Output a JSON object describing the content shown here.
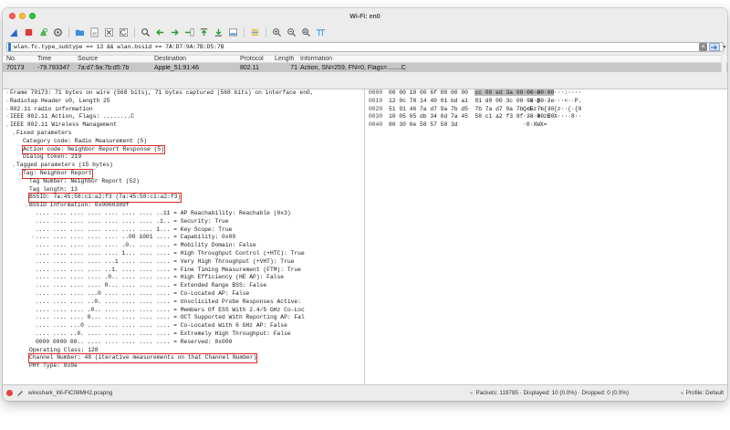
{
  "window": {
    "title": "Wi-Fi: en0"
  },
  "toolbar": {
    "buttons": [
      "shark-fin-icon",
      "stop-icon",
      "restart-icon",
      "options-gear-icon",
      "open-folder-icon",
      "save-file-icon",
      "close-file-icon",
      "reload-icon",
      "find-icon",
      "back-arrow-icon",
      "forward-arrow-icon",
      "go-to-packet-icon",
      "first-packet-icon",
      "last-packet-icon",
      "autoscroll-icon",
      "colorize-icon",
      "zoom-in-icon",
      "zoom-out-icon",
      "normal-size-icon",
      "resize-columns-icon"
    ]
  },
  "filter": {
    "text": "wlan.fc.type_subtype == 13 && wlan.bssid == 7A:D7:9A:7B:D5:7B"
  },
  "packet_list": {
    "headers": [
      "No.",
      "Time",
      "Source",
      "Destination",
      "Protocol",
      "Length",
      "Information"
    ],
    "rows": [
      {
        "no": "70173",
        "time": "-79.783347",
        "source": "7a:d7:9a:7b:d5:7b",
        "destination": "Apple_51:91:46",
        "protocol": "802.11",
        "length": "71",
        "info": "Action, SN=259, FN=0, Flags=........C"
      }
    ]
  },
  "details": {
    "lines": [
      {
        "indent": 0,
        "arrow": ">",
        "text": "Frame 70173: 71 bytes on wire (568 bits), 71 bytes captured (568 bits) on interface en0,",
        "sel": false
      },
      {
        "indent": 0,
        "arrow": ">",
        "text": "Radiotap Header v0, Length 25",
        "sel": false
      },
      {
        "indent": 0,
        "arrow": ">",
        "text": "802.11 radio information",
        "sel": false
      },
      {
        "indent": 0,
        "arrow": ">",
        "text": "IEEE 802.11 Action, Flags: ........C",
        "sel": false
      },
      {
        "indent": 0,
        "arrow": "v",
        "text": "IEEE 802.11 Wireless Management",
        "sel": false
      },
      {
        "indent": 1,
        "arrow": "v",
        "text": "Fixed parameters",
        "sel": false
      },
      {
        "indent": 2,
        "arrow": "",
        "text": "Category code: Radio Measurement (5)",
        "sel": false
      },
      {
        "indent": 2,
        "arrow": "",
        "text": "Action code: Neighbor Report Response (5)",
        "sel": true
      },
      {
        "indent": 2,
        "arrow": "",
        "text": "Dialog token: 219",
        "sel": false
      },
      {
        "indent": 1,
        "arrow": "v",
        "text": "Tagged parameters (15 bytes)",
        "sel": false
      },
      {
        "indent": 2,
        "arrow": "v",
        "text": "Tag: Neighbor Report",
        "sel": true
      },
      {
        "indent": 3,
        "arrow": "",
        "text": "Tag Number: Neighbor Report (52)",
        "sel": false
      },
      {
        "indent": 3,
        "arrow": "",
        "text": "Tag length: 13",
        "sel": false
      },
      {
        "indent": 3,
        "arrow": "",
        "text": "BSSID: 7a:45:58:c1:a2:f3 (7a:45:58:c1:a2:f3)",
        "sel": true
      },
      {
        "indent": 3,
        "arrow": "v",
        "text": "BSSID Information: 0x0000389f",
        "sel": false
      },
      {
        "indent": 4,
        "arrow": "",
        "text": ".... .... .... .... .... .... .... ..11 = AP Reachability: Reachable (0x3)",
        "sel": false
      },
      {
        "indent": 4,
        "arrow": "",
        "text": ".... .... .... .... .... .... .... .1.. = Security: True",
        "sel": false
      },
      {
        "indent": 4,
        "arrow": "",
        "text": ".... .... .... .... .... .... .... 1... = Key Scope: True",
        "sel": false
      },
      {
        "indent": 4,
        "arrow": ">",
        "text": ".... .... .... .... .... ..00 1001 .... = Capability: 0x09",
        "sel": false
      },
      {
        "indent": 4,
        "arrow": "",
        "text": ".... .... .... .... .... .0.. .... .... = Mobility Domain: False",
        "sel": false
      },
      {
        "indent": 4,
        "arrow": "",
        "text": ".... .... .... .... .... 1... .... .... = High Throughput Control (+HTC): True",
        "sel": false
      },
      {
        "indent": 4,
        "arrow": "",
        "text": ".... .... .... .... ...1 .... .... .... = Very High Throughput (+VHT): True",
        "sel": false
      },
      {
        "indent": 4,
        "arrow": "",
        "text": ".... .... .... .... ..1. .... .... .... = Fine Timing Measurement (FTM): True",
        "sel": false
      },
      {
        "indent": 4,
        "arrow": "",
        "text": ".... .... .... .... .0.. .... .... .... = High Efficiency (HE AP): False",
        "sel": false
      },
      {
        "indent": 4,
        "arrow": "",
        "text": ".... .... .... .... 0... .... .... .... = Extended Range BSS: False",
        "sel": false
      },
      {
        "indent": 4,
        "arrow": "",
        "text": ".... .... .... ...0 .... .... .... .... = Co-Located AP: False",
        "sel": false
      },
      {
        "indent": 4,
        "arrow": "",
        "text": ".... .... .... ..0. .... .... .... .... = Unsolicited Probe Responses Active:",
        "sel": false
      },
      {
        "indent": 4,
        "arrow": "",
        "text": ".... .... .... .0.. .... .... .... .... = Members Of ESS With 2.4/5 GHz Co-Loc",
        "sel": false
      },
      {
        "indent": 4,
        "arrow": "",
        "text": ".... .... .... 0... .... .... .... .... = OCT Supported With Reporting AP: Fal",
        "sel": false
      },
      {
        "indent": 4,
        "arrow": "",
        "text": ".... .... ...0 .... .... .... .... .... = Co-Located With 6 GHz AP: False",
        "sel": false
      },
      {
        "indent": 4,
        "arrow": "",
        "text": ".... .... ..0. .... .... .... .... .... = Extremely High Throughput: False",
        "sel": false
      },
      {
        "indent": 4,
        "arrow": "",
        "text": "0000 0000 00.. .... .... .... .... .... = Reserved: 0x000",
        "sel": false
      },
      {
        "indent": 3,
        "arrow": "",
        "text": "Operating Class: 128",
        "sel": false
      },
      {
        "indent": 3,
        "arrow": "",
        "text": "Channel Number: 48 (iterative measurements on that Channel Number)",
        "sel": true
      },
      {
        "indent": 3,
        "arrow": "",
        "text": "PHY Type: 0x0e",
        "sel": false
      }
    ]
  },
  "hex": {
    "lines": [
      {
        "offset": "0000",
        "bytes_a": "00 00 19 00 6f 08 00 00  ",
        "bytes_hl": "cc 06 ed 3a 00 00 00 00",
        "ascii": "····o··· ···:····"
      },
      {
        "offset": "0010",
        "bytes_a": "12 0c 78 14 40 01 bd a1  01 d0 00 3c 00 98 50 2e",
        "bytes_hl": "",
        "ascii": "··x·@··· ···<··P."
      },
      {
        "offset": "0020",
        "bytes_a": "51 91 46 7a d7 9a 7b d5  7b 7a d7 9a 7b d5 7b 30",
        "bytes_hl": "",
        "ascii": "Q·Fz··{· {z··{·{0"
      },
      {
        "offset": "0030",
        "bytes_a": "10 05 05 db 34 0d 7a 45  58 c1 a2 f3 9f 38 00 00",
        "bytes_hl": "",
        "ascii": "····4·zE X····8··"
      },
      {
        "offset": "0040",
        "bytes_a": "80 30 0e 58 57 58 3d",
        "bytes_hl": "",
        "ascii": "·0·XWX="
      }
    ]
  },
  "status": {
    "file": "wireshark_Wi-FiC08MH2.pcapng",
    "stats": "Packets: 119785 · Displayed: 10 (0.0%) · Dropped: 0 (0.0%)",
    "profile": "Profile: Default"
  }
}
